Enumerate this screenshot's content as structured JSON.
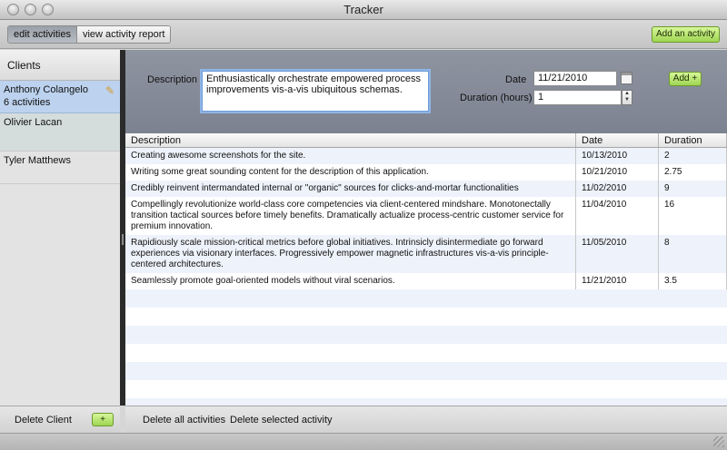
{
  "window": {
    "title": "Tracker"
  },
  "toolbar": {
    "tabs": [
      "edit activities",
      "view activity report"
    ],
    "add_activity": "Add an activity"
  },
  "sidebar": {
    "header": "Clients",
    "clients": [
      {
        "name": "Anthony Colangelo",
        "detail": "6 activities"
      },
      {
        "name": "Olivier Lacan"
      },
      {
        "name": "Tyler Matthews"
      }
    ],
    "delete_client": "Delete Client",
    "add_client": "+"
  },
  "form": {
    "description_label": "Description",
    "description_value": "Enthusiastically orchestrate empowered process improvements vis-a-vis ubiquitous schemas.",
    "date_label": "Date",
    "date_value": "11/21/2010",
    "duration_label": "Duration (hours)",
    "duration_value": "1",
    "add_button": "Add +"
  },
  "table": {
    "headers": [
      "Description",
      "Date",
      "Duration"
    ],
    "rows": [
      {
        "description": "Creating awesome screenshots for the site.",
        "date": "10/13/2010",
        "duration": "2"
      },
      {
        "description": "Writing some great sounding content for the description of this application.",
        "date": "10/21/2010",
        "duration": "2.75"
      },
      {
        "description": "Credibly reinvent intermandated internal or \"organic\" sources for clicks-and-mortar functionalities",
        "date": "11/02/2010",
        "duration": "9"
      },
      {
        "description": "Compellingly revolutionize world-class core competencies via client-centered mindshare. Monotonectally transition tactical sources before timely benefits. Dramatically actualize process-centric customer service for premium innovation.",
        "date": "11/04/2010",
        "duration": "16"
      },
      {
        "description": "Rapidiously scale mission-critical metrics before global initiatives. Intrinsicly disintermediate go forward experiences via visionary interfaces. Progressively empower magnetic infrastructures vis-a-vis principle-centered architectures.",
        "date": "11/05/2010",
        "duration": "8"
      },
      {
        "description": "Seamlessly promote goal-oriented models without viral scenarios.",
        "date": "11/21/2010",
        "duration": "3.5"
      }
    ]
  },
  "bottom": {
    "delete_all": "Delete all activities",
    "delete_selected": "Delete selected activity"
  },
  "icons": {
    "edit": "pencil-icon",
    "calendar": "calendar-icon",
    "stepper": "stepper-icon",
    "resize": "resize-grip-icon"
  },
  "colors": {
    "accent_green": "#9fd552",
    "selection_blue": "#bcd2ee",
    "form_panel": "#8e94a0"
  }
}
